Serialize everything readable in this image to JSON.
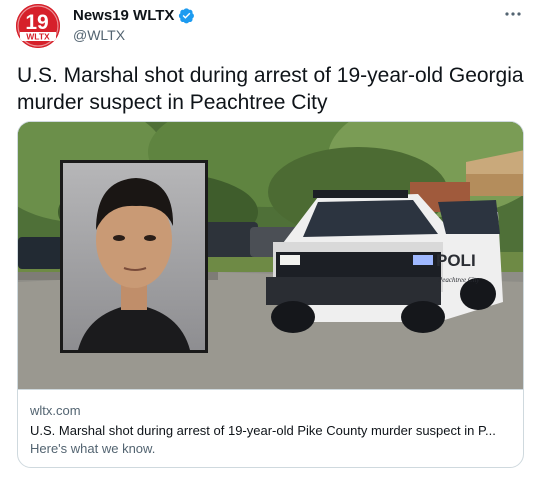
{
  "author": {
    "display_name": "News19 WLTX",
    "handle": "@WLTX",
    "avatar_text_top": "19",
    "avatar_text_bottom": "WLTX"
  },
  "tweet": {
    "text": "U.S. Marshal shot during arrest of 19-year-old Georgia murder suspect in Peachtree City"
  },
  "card": {
    "domain": "wltx.com",
    "title": "U.S. Marshal shot during arrest of 19-year-old Pike County murder suspect in P...",
    "description": "Here's what we know.",
    "image_vehicle_text": "POLI",
    "image_vehicle_small_text": "Peachtree City"
  },
  "icons": {
    "verified": "verified-badge-icon",
    "more": "more-options-icon"
  },
  "colors": {
    "brand_red": "#d6202a",
    "verified_blue": "#1d9bf0",
    "secondary_text": "#536471",
    "border": "#cfd9de"
  }
}
